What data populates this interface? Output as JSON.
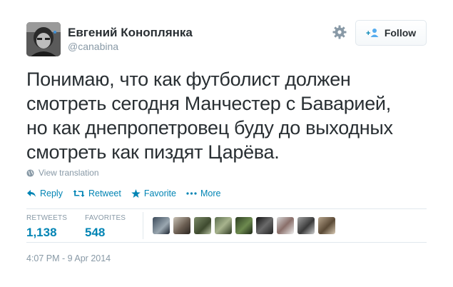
{
  "user": {
    "name": "Евгений Коноплянка",
    "handle": "@canabina"
  },
  "header": {
    "follow_label": "Follow"
  },
  "tweet": {
    "lines": [
      "Понимаю, что как футболист должен",
      "смотреть сегодня Манчестер с Баварией,",
      "но как днепропетровец буду до выходных",
      "смотреть как пиздят Царёва."
    ],
    "view_translation": "View translation"
  },
  "actions": {
    "reply": "Reply",
    "retweet": "Retweet",
    "favorite": "Favorite",
    "more": "More"
  },
  "stats": {
    "retweets_label": "RETWEETS",
    "retweets_value": "1,138",
    "favorites_label": "FAVORITES",
    "favorites_value": "548"
  },
  "timestamp": "4:07 PM - 9 Apr 2014",
  "colors": {
    "link": "#0084b4",
    "muted": "#8899a6",
    "text": "#292f33",
    "border": "#e1e8ed"
  },
  "icons": {
    "gear": "gear-icon",
    "follow": "add-user-icon",
    "globe": "globe-icon",
    "reply": "reply-icon",
    "retweet": "retweet-icon",
    "favorite": "star-icon",
    "more": "more-dots-icon"
  }
}
